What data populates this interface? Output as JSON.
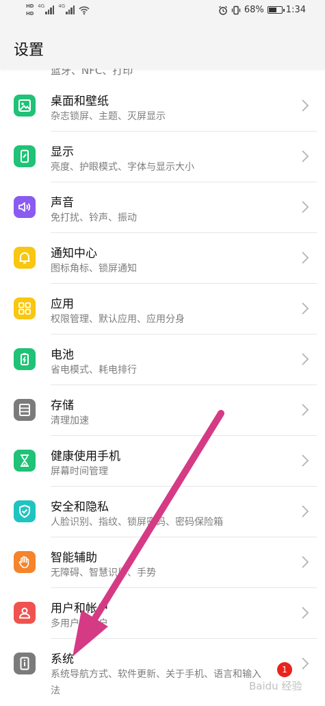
{
  "status": {
    "hd1": "HD",
    "hd2": "HD",
    "net1": "4G",
    "net2": "4G",
    "battery_pct": "68%",
    "battery_level": 0.68,
    "time": "1:34"
  },
  "header": {
    "title": "设置",
    "peek_text": "蓝牙、NFC、打印"
  },
  "items": [
    {
      "label": "桌面和壁纸",
      "sub": "杂志锁屏、主题、灭屏显示",
      "icon": "image-icon",
      "color": "#1fc276"
    },
    {
      "label": "显示",
      "sub": "亮度、护眼模式、字体与显示大小",
      "icon": "phone-display-icon",
      "color": "#1fc276"
    },
    {
      "label": "声音",
      "sub": "免打扰、铃声、振动",
      "icon": "speaker-icon",
      "color": "#8a5bf0"
    },
    {
      "label": "通知中心",
      "sub": "图标角标、锁屏通知",
      "icon": "bell-icon",
      "color": "#f9c611"
    },
    {
      "label": "应用",
      "sub": "权限管理、默认应用、应用分身",
      "icon": "apps-grid-icon",
      "color": "#f9c611"
    },
    {
      "label": "电池",
      "sub": "省电模式、耗电排行",
      "icon": "battery-icon",
      "color": "#1fc276"
    },
    {
      "label": "存储",
      "sub": "清理加速",
      "icon": "storage-icon",
      "color": "#7b7b7b"
    },
    {
      "label": "健康使用手机",
      "sub": "屏幕时间管理",
      "icon": "hourglass-icon",
      "color": "#1fc276"
    },
    {
      "label": "安全和隐私",
      "sub": "人脸识别、指纹、锁屏密码、密码保险箱",
      "icon": "shield-icon",
      "color": "#1fc4c0"
    },
    {
      "label": "智能辅助",
      "sub": "无障碍、智慧识屏、手势",
      "icon": "hand-icon",
      "color": "#f5842c"
    },
    {
      "label": "用户和帐户",
      "sub": "多用户、帐户",
      "icon": "user-icon",
      "color": "#ef5350"
    },
    {
      "label": "系统",
      "sub": "系统导航方式、软件更新、关于手机、语言和输入法",
      "icon": "system-info-icon",
      "color": "#7b7b7b",
      "badge": "1"
    }
  ],
  "watermark": "Baidu 经验",
  "colors": {
    "arrow": "#d53a85",
    "badge": "#e8231e"
  }
}
